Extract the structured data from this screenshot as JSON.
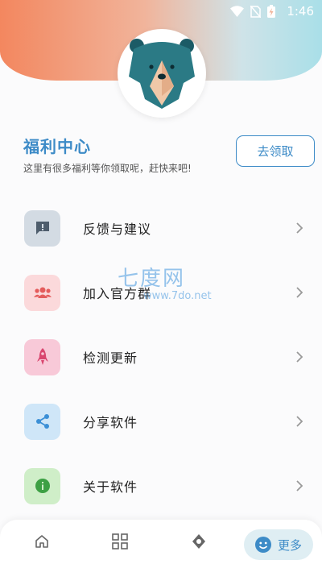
{
  "status_bar": {
    "time": "1:46"
  },
  "welfare": {
    "title": "福利中心",
    "subtitle": "这里有很多福利等你领取呢，赶快来吧!",
    "claim_label": "去领取"
  },
  "menu": [
    {
      "label": "反馈与建议",
      "icon": "feedback-icon",
      "bg": "#d3dbe3",
      "color": "#4e5d6c"
    },
    {
      "label": "加入官方群",
      "icon": "group-icon",
      "bg": "#fbd9db",
      "color": "#e45c5c"
    },
    {
      "label": "检测更新",
      "icon": "rocket-icon",
      "bg": "#f8c9d8",
      "color": "#d9466f"
    },
    {
      "label": "分享软件",
      "icon": "share-icon",
      "bg": "#cfe6f8",
      "color": "#3b8fd6"
    },
    {
      "label": "关于软件",
      "icon": "info-icon",
      "bg": "#cfeec8",
      "color": "#3da044"
    }
  ],
  "watermark": {
    "main": "七度网",
    "sub": "www.7do.net"
  },
  "bottom_nav": {
    "items": [
      "home-icon",
      "grid-icon",
      "compass-icon"
    ],
    "more_label": "更多",
    "active_color": "#3d8bc7"
  }
}
